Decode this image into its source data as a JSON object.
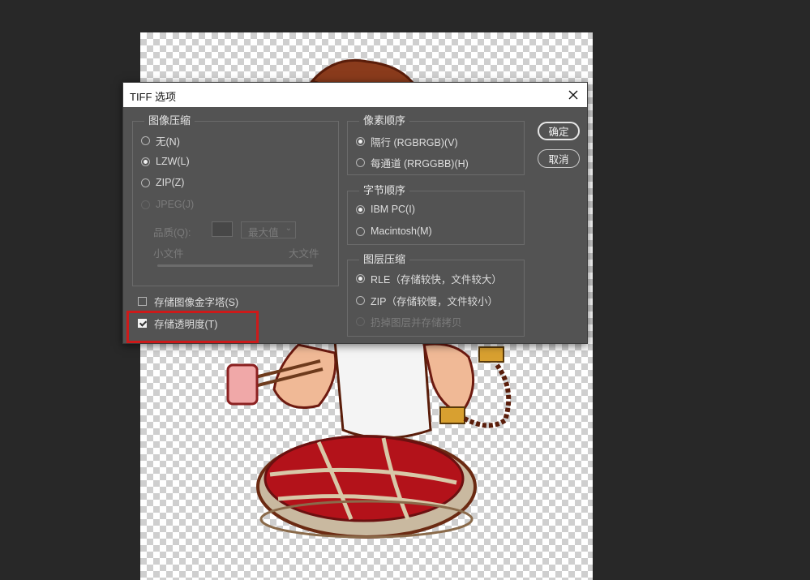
{
  "dialog": {
    "title": "TIFF 选项",
    "image_compression": {
      "legend": "图像压缩",
      "options": [
        "无(N)",
        "LZW(L)",
        "ZIP(Z)",
        "JPEG(J)"
      ],
      "selected": "LZW(L)"
    },
    "quality": {
      "label": "品质(Q):",
      "selected_value": "最大值",
      "small_label": "小文件",
      "large_label": "大文件"
    },
    "checkboxes": {
      "save_pyramid": "存储图像金字塔(S)",
      "save_transparency": "存储透明度(T)"
    },
    "pixel_order": {
      "legend": "像素顺序",
      "options": [
        "隔行 (RGBRGB)(V)",
        "每通道 (RRGGBB)(H)"
      ],
      "selected": "隔行 (RGBRGB)(V)"
    },
    "byte_order": {
      "legend": "字节顺序",
      "options": [
        "IBM PC(I)",
        "Macintosh(M)"
      ],
      "selected": "IBM PC(I)"
    },
    "layer_compression": {
      "legend": "图层压缩",
      "options": [
        "RLE（存储较快，文件较大）",
        "ZIP（存储较慢，文件较小）",
        "扔掉图层并存储拷贝"
      ],
      "selected": "RLE（存储较快，文件较大）"
    },
    "buttons": {
      "ok": "确定",
      "cancel": "取消"
    }
  },
  "colors": {
    "dialog_bg": "#535353",
    "app_bg": "#282828",
    "highlight": "#cc1a1a"
  }
}
